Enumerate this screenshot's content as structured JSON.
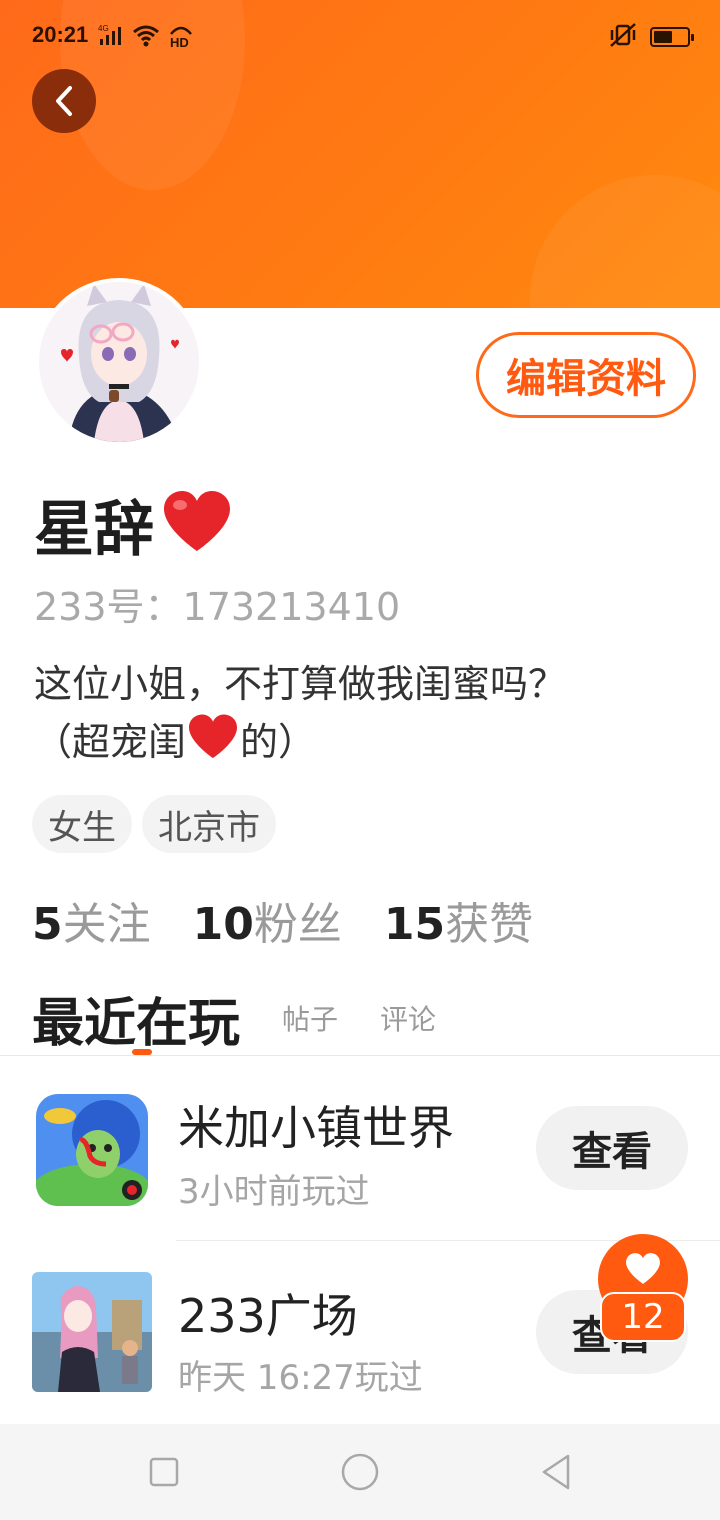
{
  "status_bar": {
    "time": "20:21",
    "network": "4G",
    "hd": "HD"
  },
  "header": {
    "bg_color": "#ff6a1a"
  },
  "profile": {
    "name": "星辞",
    "user_id": "233号：173213410",
    "bio": "这位小姐，不打算做我闺蜜吗？",
    "bio_line2_start": "（超宠闺",
    "bio_line2_end": "的）",
    "tags": [
      "女生",
      "北京市"
    ],
    "edit_label": "编辑资料"
  },
  "stats": [
    {
      "num": "5",
      "label": "关注"
    },
    {
      "num": "10",
      "label": "粉丝"
    },
    {
      "num": "15",
      "label": "获赞"
    }
  ],
  "tabs": {
    "active": "最近在玩",
    "posts": "帖子",
    "comments": "评论"
  },
  "games": [
    {
      "title": "米加小镇世界",
      "sub": "3小时前玩过",
      "button": "查看",
      "icon": "game-icon-toca"
    },
    {
      "title": "233广场",
      "sub": "昨天 16:27玩过",
      "button": "查看",
      "icon": "game-icon-plaza"
    }
  ],
  "float_like": {
    "count": "12",
    "icon": "heart-icon"
  },
  "colors": {
    "accent": "#ff5a10",
    "heart": "#e5252a"
  }
}
